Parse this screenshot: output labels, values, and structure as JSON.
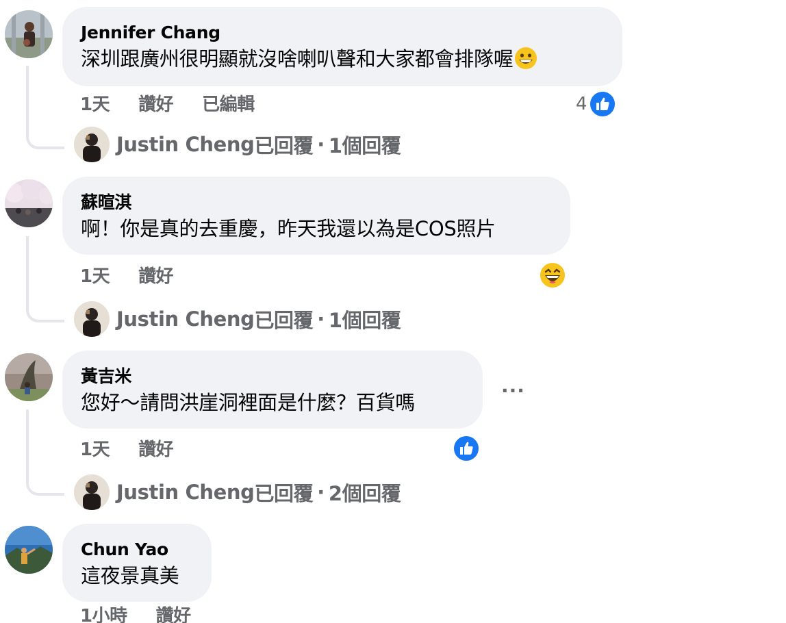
{
  "comments": [
    {
      "author": "Jennifer Chang",
      "text": "深圳跟廣州很明顯就沒啥喇叭聲和大家都會排隊喔",
      "text_emoji": "grinning-face-emoji",
      "time": "1天",
      "like_label": "讚好",
      "edited_label": "已編輯",
      "reaction_count": "4",
      "reaction_icon": "like-icon",
      "reply_author": "Justin Cheng",
      "reply_verb": "已回覆",
      "reply_dot": "·",
      "reply_count": "1個回覆"
    },
    {
      "author": "蘇暄淇",
      "text": "啊！你是真的去重慶，昨天我還以為是COS照片",
      "time": "1天",
      "like_label": "讚好",
      "reaction_icon": "haha-icon",
      "reply_author": "Justin Cheng",
      "reply_verb": "已回覆",
      "reply_dot": "·",
      "reply_count": "1個回覆"
    },
    {
      "author": "黃吉米",
      "text": "您好～請問洪崖洞裡面是什麼？百貨嗎",
      "time": "1天",
      "like_label": "讚好",
      "reaction_icon": "like-icon",
      "more_label": "···",
      "reply_author": "Justin Cheng",
      "reply_verb": "已回覆",
      "reply_dot": "·",
      "reply_count": "2個回覆"
    },
    {
      "author": "Chun Yao",
      "text": "這夜景真美",
      "time": "1小時",
      "like_label": "讚好"
    }
  ],
  "colors": {
    "bubble": "#f0f2f5",
    "secondary_text": "#65676b",
    "like_blue": "#1877f2",
    "thread_line": "#e4e6eb"
  }
}
